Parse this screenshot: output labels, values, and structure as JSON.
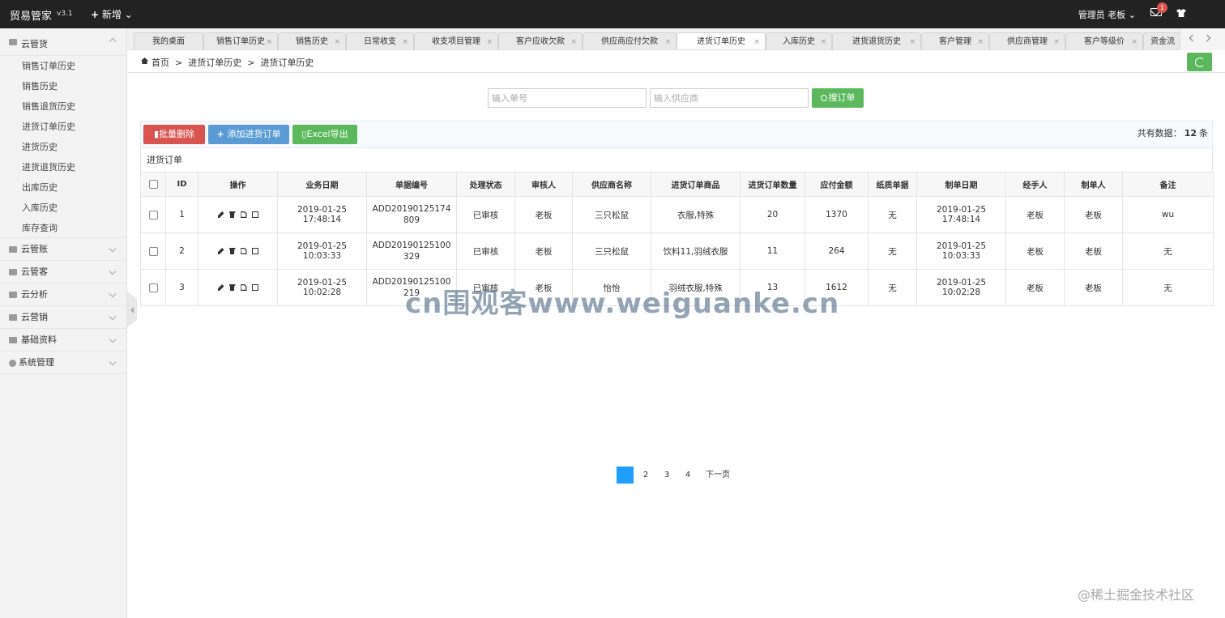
{
  "topbar": {
    "brand": "贸易管家",
    "version": "v3.1",
    "new_label": "新增",
    "role": "管理员",
    "user": "老板",
    "mail_count": "1"
  },
  "sidebar": {
    "groups": [
      {
        "label": "云管货",
        "icon": "box-icon",
        "expanded": true,
        "items": [
          "销售订单历史",
          "销售历史",
          "销售退货历史",
          "进货订单历史",
          "进货历史",
          "进货退货历史",
          "出库历史",
          "入库历史",
          "库存查询"
        ]
      },
      {
        "label": "云管账",
        "icon": "ledger-icon"
      },
      {
        "label": "云管客",
        "icon": "user-icon"
      },
      {
        "label": "云分析",
        "icon": "bar-chart-icon"
      },
      {
        "label": "云营销",
        "icon": "gift-icon"
      },
      {
        "label": "基础资料",
        "icon": "database-icon"
      },
      {
        "label": "系统管理",
        "icon": "gear-icon"
      }
    ]
  },
  "tabs": [
    {
      "label": "我的桌面",
      "closable": false
    },
    {
      "label": "销售订单历史",
      "closable": true
    },
    {
      "label": "销售历史",
      "closable": true
    },
    {
      "label": "日常收支",
      "closable": true
    },
    {
      "label": "收支项目管理",
      "closable": true
    },
    {
      "label": "客户应收欠款",
      "closable": true
    },
    {
      "label": "供应商应付欠款",
      "closable": true
    },
    {
      "label": "进货订单历史",
      "closable": true,
      "active": true
    },
    {
      "label": "入库历史",
      "closable": true
    },
    {
      "label": "进货退货历史",
      "closable": true
    },
    {
      "label": "客户管理",
      "closable": true
    },
    {
      "label": "供应商管理",
      "closable": true
    },
    {
      "label": "客户等级价",
      "closable": true
    },
    {
      "label": "资金流",
      "closable": false
    }
  ],
  "breadcrumb": {
    "home": "首页",
    "level1": "进货订单历史",
    "level2": "进货订单历史",
    "separator": ">"
  },
  "search": {
    "order_placeholder": "输入单号",
    "supplier_placeholder": "输入供应商",
    "button_label": "搜订单"
  },
  "toolbar": {
    "batch_delete": "批量删除",
    "add_order": "添加进货订单",
    "excel_export": "Excel导出",
    "count_prefix": "共有数据：",
    "count_value": "12",
    "count_suffix": "条"
  },
  "table": {
    "title": "进货订单",
    "columns": [
      "ID",
      "操作",
      "业务日期",
      "单据编号",
      "处理状态",
      "审核人",
      "供应商名称",
      "进货订单商品",
      "进货订单数量",
      "应付金额",
      "纸质单据",
      "制单日期",
      "经手人",
      "制单人",
      "备注"
    ],
    "rows": [
      {
        "id": "1",
        "date": "2019-01-25 17:48:14",
        "code": "ADD20190125174809",
        "status": "已审核",
        "auditor": "老板",
        "supplier": "三只松鼠",
        "goods": "衣服,特殊",
        "qty": "20",
        "amount": "1370",
        "paper": "无",
        "made_date": "2019-01-25 17:48:14",
        "handler": "老板",
        "maker": "老板",
        "note": "wu"
      },
      {
        "id": "2",
        "date": "2019-01-25 10:03:33",
        "code": "ADD20190125100329",
        "status": "已审核",
        "auditor": "老板",
        "supplier": "三只松鼠",
        "goods": "饮料11,羽绒衣服",
        "qty": "11",
        "amount": "264",
        "paper": "无",
        "made_date": "2019-01-25 10:03:33",
        "handler": "老板",
        "maker": "老板",
        "note": "无"
      },
      {
        "id": "3",
        "date": "2019-01-25 10:02:28",
        "code": "ADD20190125100219",
        "status": "已审核",
        "auditor": "老板",
        "supplier": "怡怡",
        "goods": "羽绒衣服,特殊",
        "qty": "13",
        "amount": "1612",
        "paper": "无",
        "made_date": "2019-01-25 10:02:28",
        "handler": "老板",
        "maker": "老板",
        "note": "无"
      }
    ]
  },
  "pagination": {
    "current": "1",
    "pages": [
      "2",
      "3",
      "4"
    ],
    "next": "下一页"
  },
  "watermark": "cn围观客www.weiguanke.cn",
  "footer_watermark": "@稀土掘金技术社区",
  "colors": {
    "topbar": "#222222",
    "danger": "#d9534f",
    "primary": "#5b9bd5",
    "success": "#5cb85c",
    "page_active": "#1e9fff"
  }
}
